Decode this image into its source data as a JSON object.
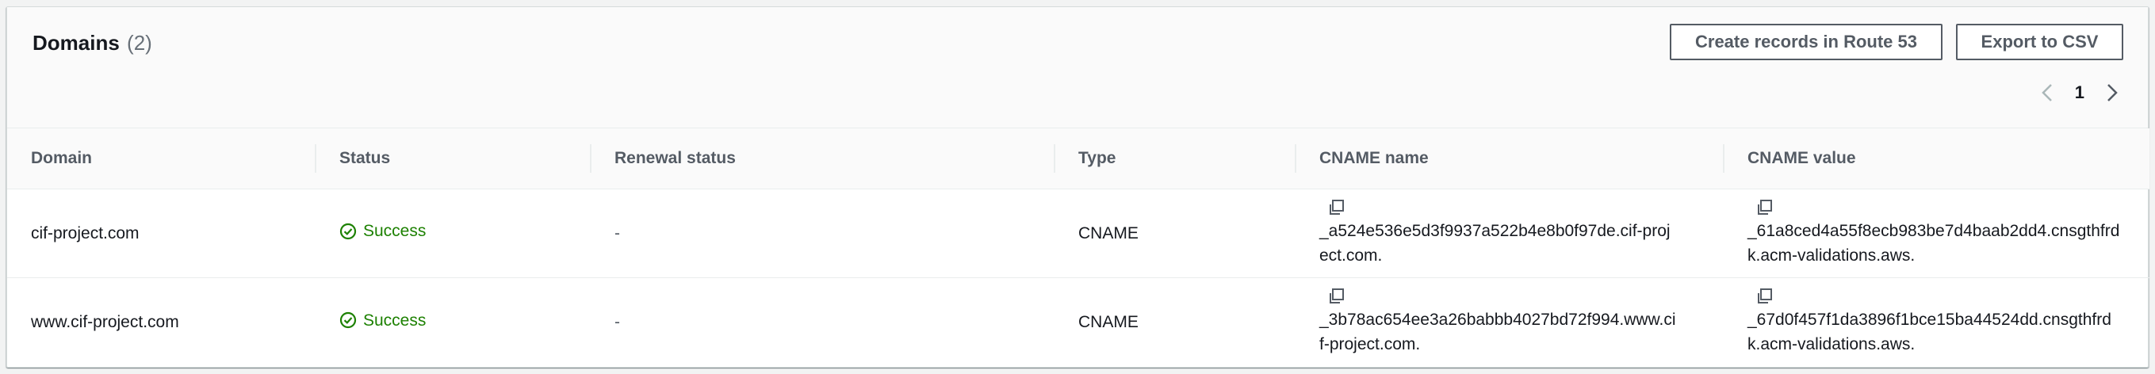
{
  "header": {
    "title": "Domains",
    "count": "(2)",
    "create_records_label": "Create records in Route 53",
    "export_label": "Export to CSV"
  },
  "pagination": {
    "current_page": "1"
  },
  "table": {
    "columns": [
      "Domain",
      "Status",
      "Renewal status",
      "Type",
      "CNAME name",
      "CNAME value"
    ],
    "rows": [
      {
        "domain": "cif-project.com",
        "status": "Success",
        "renewal_status": "-",
        "type": "CNAME",
        "cname_name": "_a524e536e5d3f9937a522b4e8b0f97de.cif-project.com.",
        "cname_value": "_61a8ced4a55f8ecb983be7d4baab2dd4.cnsgthfrdk.acm-validations.aws."
      },
      {
        "domain": "www.cif-project.com",
        "status": "Success",
        "renewal_status": "-",
        "type": "CNAME",
        "cname_name": "_3b78ac654ee3a26babbb4027bd72f994.www.cif-project.com.",
        "cname_value": "_67d0f457f1da3896f1bce15ba44524dd.cnsgthfrdk.acm-validations.aws."
      }
    ]
  },
  "colors": {
    "success": "#1d8102",
    "header_bg": "#fafafa",
    "border": "#eaeded"
  }
}
